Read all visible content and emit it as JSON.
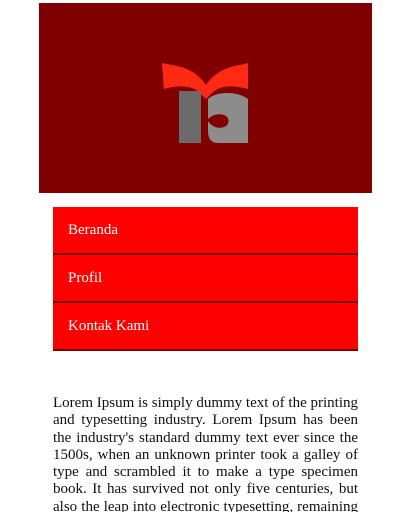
{
  "header": {
    "logo_icon": "institution-logo-icon",
    "colors": {
      "banner": "#800000",
      "logo_red": "#ff2a14",
      "logo_gray": "#6b6b6b",
      "logo_gray_light": "#8c8c8c"
    }
  },
  "nav": {
    "color": "#ff0000",
    "items": [
      {
        "label": "Beranda"
      },
      {
        "label": "Profil"
      },
      {
        "label": "Kontak Kami"
      }
    ]
  },
  "main": {
    "paragraph": "Lorem Ipsum is simply dummy text of the printing and typesetting industry. Lorem Ipsum has been the industry's standard dummy text ever since the 1500s, when an unknown printer took a galley of type and scrambled it to make a type specimen book. It has survived not only five centuries, but also the leap into electronic typesetting, remaining essentially unchanged."
  }
}
